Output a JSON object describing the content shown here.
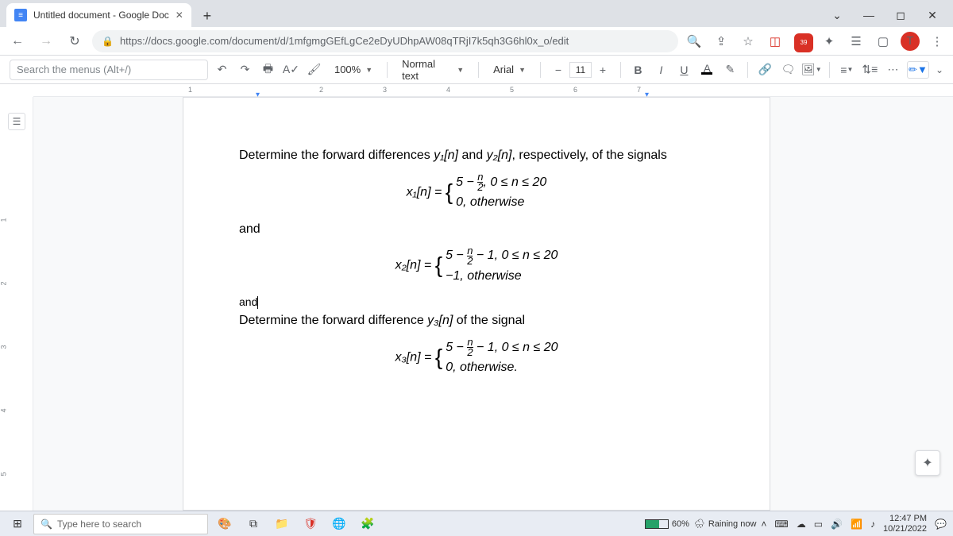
{
  "browser": {
    "tab_title": "Untitled document - Google Doc",
    "url": "https://docs.google.com/document/d/1mfgmgGEfLgCe2eDyUDhpAW08qTRjI7k5qh3G6hl0x_o/edit",
    "ext_count": "39",
    "avatar_letter": "T"
  },
  "toolbar": {
    "search_placeholder": "Search the menus (Alt+/)",
    "zoom": "100%",
    "style": "Normal text",
    "font": "Arial",
    "fontsize": "11",
    "more": "⋯"
  },
  "ruler": {
    "marks": [
      "1",
      "2",
      "3",
      "4",
      "5",
      "6",
      "7"
    ],
    "left": [
      "1",
      "2",
      "3",
      "4",
      "5"
    ]
  },
  "doc": {
    "p1": "Determine the forward differences ",
    "p1b": " and ",
    "p1c": ", respectively, of the signals",
    "y1": "y₁[n]",
    "y2": "y₂[n]",
    "eq1_lhs": "x₁[n] = ",
    "eq1_a": "5 − ",
    "eq1_a2": ",  0 ≤ n ≤ 20",
    "eq1_b": "0,   otherwise",
    "and1": "and",
    "eq2_lhs": "x₂[n] = ",
    "eq2_a": "5 − ",
    "eq2_a2": " − 1,  0 ≤ n ≤ 20",
    "eq2_b": "−1,   otherwise",
    "and2": "and",
    "p2": "Determine the forward difference ",
    "y3": "y₃[n]",
    "p2b": " of the signal",
    "eq3_lhs": "x₃[n] = ",
    "eq3_a": "5 − ",
    "eq3_a2": " − 1,  0 ≤ n ≤ 20",
    "eq3_b": "0,   otherwise.",
    "frac_n": "n",
    "frac_d": "2"
  },
  "taskbar": {
    "search": "Type here to search",
    "battery": "60%",
    "weather": "Raining now",
    "time": "12:47 PM",
    "date": "10/21/2022"
  }
}
